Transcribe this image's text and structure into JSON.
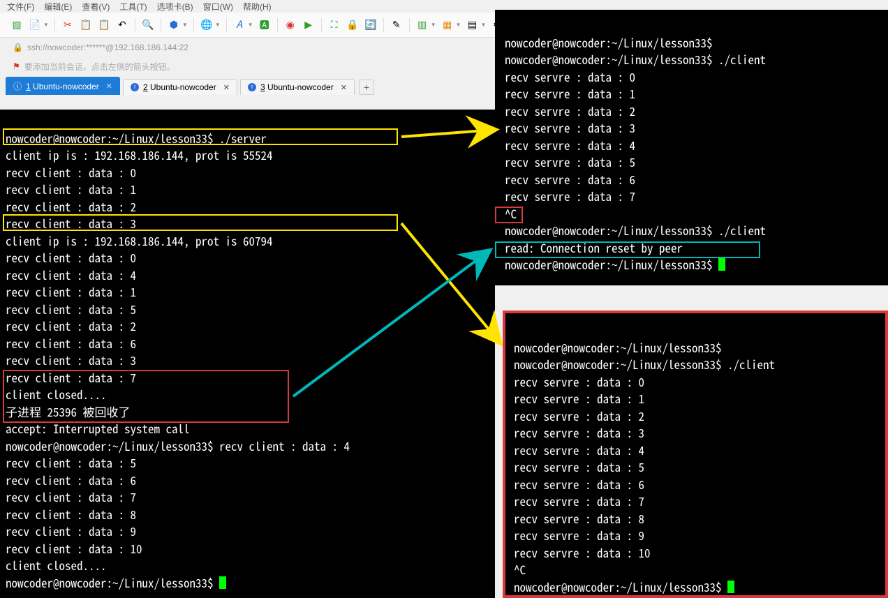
{
  "menubar": [
    "文件(F)",
    "编辑(E)",
    "查看(V)",
    "工具(T)",
    "选项卡(B)",
    "窗口(W)",
    "帮助(H)"
  ],
  "addressbar": "ssh://nowcoder:******@192.168.186.144:22",
  "hint": "要添加当前会话，点击左侧的箭头按钮。",
  "tabs": [
    {
      "label": "1 Ubuntu-nowcoder",
      "active": true
    },
    {
      "label": "2 Ubuntu-nowcoder",
      "active": false
    },
    {
      "label": "3 Ubuntu-nowcoder",
      "active": false
    }
  ],
  "prompts": {
    "server_prompt": "nowcoder@nowcoder:~/Linux/lesson33$ ",
    "server_cmd": "./server",
    "client_cmd": "./client"
  },
  "server": {
    "conn1": "client ip is : 192.168.186.144, prot is 55524",
    "recv1": [
      "recv client : data : 0",
      "recv client : data : 1",
      "recv client : data : 2",
      "recv client : data : 3"
    ],
    "conn2": "client ip is : 192.168.186.144, prot is 60794",
    "recv2": [
      "recv client : data : 0",
      "recv client : data : 4",
      "recv client : data : 1",
      "recv client : data : 5",
      "recv client : data : 2",
      "recv client : data : 6",
      "recv client : data : 3",
      "recv client : data : 7"
    ],
    "closed1": "client closed....",
    "child": "子进程 25396 被回收了",
    "accept": "accept: Interrupted system call",
    "tail_prompt_line": "nowcoder@nowcoder:~/Linux/lesson33$ recv client : data : 4",
    "recv3": [
      "recv client : data : 5",
      "recv client : data : 6",
      "recv client : data : 7",
      "recv client : data : 8",
      "recv client : data : 9",
      "recv client : data : 10"
    ],
    "closed2": "client closed...."
  },
  "client_tr": {
    "recv": [
      "recv servre : data : 0",
      "recv servre : data : 1",
      "recv servre : data : 2",
      "recv servre : data : 3",
      "recv servre : data : 4",
      "recv servre : data : 5",
      "recv servre : data : 6",
      "recv servre : data : 7"
    ],
    "ctrlc": "^C",
    "err": "read: Connection reset by peer"
  },
  "client_br": {
    "recv": [
      "recv servre : data : 0",
      "recv servre : data : 1",
      "recv servre : data : 2",
      "recv servre : data : 3",
      "recv servre : data : 4",
      "recv servre : data : 5",
      "recv servre : data : 6",
      "recv servre : data : 7",
      "recv servre : data : 8",
      "recv servre : data : 9",
      "recv servre : data : 10"
    ],
    "ctrlc": "^C"
  }
}
